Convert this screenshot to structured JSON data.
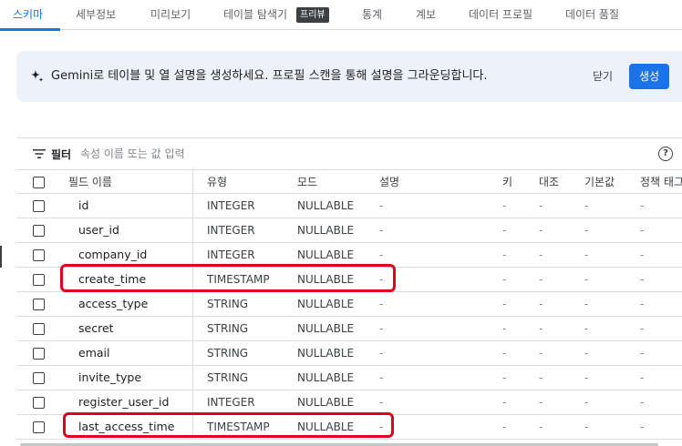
{
  "tabs": [
    {
      "label": "스키마",
      "active": true
    },
    {
      "label": "세부정보"
    },
    {
      "label": "미리보기"
    },
    {
      "label": "테이블 탐색기"
    },
    {
      "label": "통계"
    },
    {
      "label": "계보"
    },
    {
      "label": "데이터 프로필"
    },
    {
      "label": "데이터 품질"
    }
  ],
  "tab_badge": "프리뷰",
  "banner": {
    "text": "Gemini로 테이블 및 열 설명을 생성하세요. 프로필 스캔을 통해 설명을 그라운딩합니다.",
    "close_label": "닫기",
    "generate_label": "생성"
  },
  "filter": {
    "label": "필터",
    "placeholder": "속성 이름 또는 값 입력",
    "help_glyph": "?"
  },
  "table": {
    "headers": {
      "name": "필드 이름",
      "type": "유형",
      "mode": "모드",
      "description": "설명",
      "key": "키",
      "collation": "대조",
      "default": "기본값",
      "policy": "정책 태그"
    },
    "rows": [
      {
        "name": "id",
        "type": "INTEGER",
        "mode": "NULLABLE",
        "description": "-",
        "key": "-",
        "collation": "-",
        "default": "-",
        "policy": "-"
      },
      {
        "name": "user_id",
        "type": "INTEGER",
        "mode": "NULLABLE",
        "description": "-",
        "key": "-",
        "collation": "-",
        "default": "-",
        "policy": "-"
      },
      {
        "name": "company_id",
        "type": "INTEGER",
        "mode": "NULLABLE",
        "description": "-",
        "key": "-",
        "collation": "-",
        "default": "-",
        "policy": "-"
      },
      {
        "name": "create_time",
        "type": "TIMESTAMP",
        "mode": "NULLABLE",
        "description": "-",
        "key": "-",
        "collation": "-",
        "default": "-",
        "policy": "-"
      },
      {
        "name": "access_type",
        "type": "STRING",
        "mode": "NULLABLE",
        "description": "-",
        "key": "-",
        "collation": "-",
        "default": "-",
        "policy": "-"
      },
      {
        "name": "secret",
        "type": "STRING",
        "mode": "NULLABLE",
        "description": "-",
        "key": "-",
        "collation": "-",
        "default": "-",
        "policy": "-"
      },
      {
        "name": "email",
        "type": "STRING",
        "mode": "NULLABLE",
        "description": "-",
        "key": "-",
        "collation": "-",
        "default": "-",
        "policy": "-"
      },
      {
        "name": "invite_type",
        "type": "STRING",
        "mode": "NULLABLE",
        "description": "-",
        "key": "-",
        "collation": "-",
        "default": "-",
        "policy": "-"
      },
      {
        "name": "register_user_id",
        "type": "INTEGER",
        "mode": "NULLABLE",
        "description": "-",
        "key": "-",
        "collation": "-",
        "default": "-",
        "policy": "-"
      },
      {
        "name": "last_access_time",
        "type": "TIMESTAMP",
        "mode": "NULLABLE",
        "description": "-",
        "key": "-",
        "collation": "-",
        "default": "-",
        "policy": "-"
      }
    ]
  },
  "colors": {
    "accent": "#1a73e8",
    "highlight": "#e0001e",
    "banner_bg": "#edf2fa"
  }
}
